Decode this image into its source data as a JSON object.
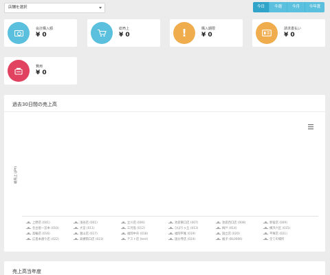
{
  "store_select": {
    "label": "店舗を選択"
  },
  "period_buttons": [
    "今日",
    "今週",
    "今月",
    "今年度"
  ],
  "cards": [
    {
      "label": "会計購入額",
      "value": "¥ 0",
      "color": "#5bc0de",
      "icon": "money-bill-icon"
    },
    {
      "label": "総売上",
      "value": "¥ 0",
      "color": "#5bc0de",
      "icon": "shopping-cart-icon"
    },
    {
      "label": "購入期限",
      "value": "¥ 0",
      "color": "#f0ad4e",
      "icon": "exclamation-icon"
    },
    {
      "label": "請求書払い",
      "value": "¥ 0",
      "color": "#f0ad4e",
      "icon": "invoice-icon"
    },
    {
      "label": "費用",
      "value": "¥ 0",
      "color": "#e0425f",
      "icon": "cash-register-icon"
    }
  ],
  "sales_panel": {
    "title": "過去30日間の売上高",
    "chart_data": {
      "type": "line",
      "ylabel": "総売上 (JPY)",
      "series": [
        {
          "name": "上野店 (001)",
          "values": []
        },
        {
          "name": "浅谷店 (001)",
          "values": []
        },
        {
          "name": "立川店 (006)",
          "values": []
        },
        {
          "name": "池袋東口店 (007)",
          "values": []
        },
        {
          "name": "池袋西口店 (008)",
          "values": []
        },
        {
          "name": "新宿店 (009)",
          "values": []
        },
        {
          "name": "名古屋一宮本 (010)",
          "values": []
        },
        {
          "name": "大宮 (011)",
          "values": []
        },
        {
          "name": "三河島 (012)",
          "values": []
        },
        {
          "name": "ひばりヶ丘 (013)",
          "values": []
        },
        {
          "name": "梅戸 (014)",
          "values": []
        },
        {
          "name": "横浜六区 (015)",
          "values": []
        },
        {
          "name": "高輪店 (016)",
          "values": []
        },
        {
          "name": "富山店 (017)",
          "values": []
        },
        {
          "name": "福岡中央 (018)",
          "values": []
        },
        {
          "name": "福岡平尾 (019)",
          "values": []
        },
        {
          "name": "国立店 (020)",
          "values": []
        },
        {
          "name": "平塚店 (021)",
          "values": []
        },
        {
          "name": "広島本通り店 (022)",
          "values": []
        },
        {
          "name": "高槻南口店 (023)",
          "values": []
        },
        {
          "name": "テスト店 (test)",
          "values": []
        },
        {
          "name": "国分寺店 (024)",
          "values": []
        },
        {
          "name": "裾子 (BL0006)",
          "values": []
        },
        {
          "name": "全ての場所",
          "values": []
        }
      ]
    }
  },
  "year_panel": {
    "title": "売上高当年度"
  }
}
